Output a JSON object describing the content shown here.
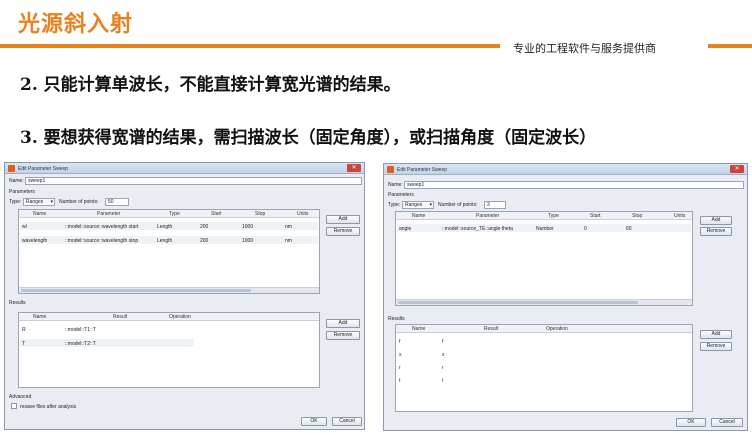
{
  "slide": {
    "title": "光源斜入射",
    "company": "专业的工程软件与服务提供商",
    "point1": "2. 只能计算单波长，不能直接计算宽光谱的结果。",
    "point2": "3. 要想获得宽谱的结果，需扫描波长（固定角度），或扫描角度（固定波长）",
    "accent_color": "#e8821e"
  },
  "dialog_left": {
    "title": "Edit Parameter Sweep",
    "name_label": "Name:",
    "name_value": "sweep1",
    "parameters_label": "Parameters",
    "type_label": "Type:",
    "type_value": "Ranges",
    "points_label": "Number of points:",
    "points_value": "50",
    "param_headers": [
      "Name",
      "Parameter",
      "Type",
      "Start",
      "Stop",
      "Units"
    ],
    "params": [
      {
        "name": "wl",
        "parameter": "::model::source::wavelength start",
        "type": "Length",
        "start": "200",
        "stop": "1000",
        "units": "nm"
      },
      {
        "name": "wavelength",
        "parameter": "::model::source::wavelength stop",
        "type": "Length",
        "start": "200",
        "stop": "1000",
        "units": "nm"
      }
    ],
    "add": "Add",
    "remove": "Remove",
    "results_label": "Results",
    "result_headers": [
      "Name",
      "Result",
      "Operation"
    ],
    "results": [
      {
        "name": "R",
        "result": "::model::T1::T"
      },
      {
        "name": "T",
        "result": "::model::T2::T"
      }
    ],
    "advanced_label": "Advanced",
    "resave_label": "resave files after analysis",
    "ok": "OK",
    "cancel": "Cancel"
  },
  "dialog_right": {
    "title": "Edit Parameter Sweep",
    "name_label": "Name:",
    "name_value": "sweep1",
    "parameters_label": "Parameters",
    "type_label": "Type:",
    "type_value": "Ranges",
    "points_label": "Number of points:",
    "points_value": "3",
    "param_headers": [
      "Name",
      "Parameter",
      "Type",
      "Start",
      "Stop",
      "Units"
    ],
    "params": [
      {
        "name": "angle",
        "parameter": "::model::source_TE::angle theta",
        "type": "Number",
        "start": "0",
        "stop": "60",
        "units": ""
      }
    ],
    "add": "Add",
    "remove": "Remove",
    "results_label": "Results",
    "result_headers": [
      "Name",
      "Result",
      "Operation"
    ],
    "results": [
      {
        "name": "f",
        "result": "f"
      },
      {
        "name": "x",
        "result": "x"
      },
      {
        "name": "r",
        "result": "r"
      },
      {
        "name": "t",
        "result": "t"
      }
    ],
    "ok": "OK",
    "cancel": "Cancel"
  }
}
